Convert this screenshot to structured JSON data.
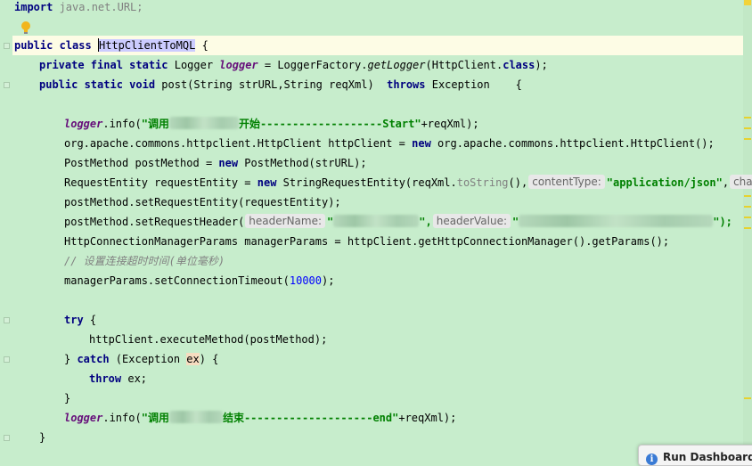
{
  "code": {
    "l0": {
      "kw": "import",
      "rest": " java.net.URL;"
    },
    "l1": {
      "kw1": "public",
      "kw2": "class",
      "cls_first": "H",
      "cls_rest": "ttpClientToMQL",
      "brace": " {"
    },
    "l2": {
      "kw": "private final static",
      "type": " Logger ",
      "field": "logger",
      "rest1": " = LoggerFactory.",
      "method": "getLogger",
      "rest2": "(HttpClient.",
      "kwclass": "class",
      "end": ");"
    },
    "l3": {
      "kw1": "public static void",
      "sig": " post(String strURL,String reqXml)  ",
      "kw2": "throws",
      "rest": " Exception    {"
    },
    "l4": {
      "field": "logger",
      "call": ".info(",
      "str1": "\"调用",
      "str2": "开始-------------------Start\"",
      "rest": "+reqXml);"
    },
    "l5": {
      "pre": "org.apache.commons.httpclient.HttpClient httpClient = ",
      "kw": "new",
      "post": " org.apache.commons.httpclient.HttpClient();"
    },
    "l6": {
      "pre": "PostMethod postMethod = ",
      "kw": "new",
      "post": " PostMethod(strURL);"
    },
    "l7": {
      "pre": "RequestEntity requestEntity = ",
      "kw": "new",
      "post": " StringRequestEntity(reqXml.",
      "m": "toString",
      "after": "(),",
      "hint1": "contentType:",
      "str": "\"application/json\"",
      "comma": ",",
      "hint2": "charse"
    },
    "l8": {
      "text": "postMethod.setRequestEntity(requestEntity);"
    },
    "l9": {
      "pre": "postMethod.setRequestHeader(",
      "hint1": "headerName:",
      "q1": "\"",
      "c1": "\",",
      "hint2": "headerValue:",
      "q2": "\"",
      "c2": "\");"
    },
    "l10": {
      "text": "HttpConnectionManagerParams managerParams = httpClient.getHttpConnectionManager().getParams();"
    },
    "l11": {
      "cmt": "// 设置连接超时时间(单位毫秒)"
    },
    "l12": {
      "pre": "managerParams.setConnectionTimeout(",
      "num": "10000",
      "post": ");"
    },
    "l13": {
      "kw": "try",
      "rest": " {"
    },
    "l14": {
      "text": "httpClient.executeMethod(postMethod);"
    },
    "l15": {
      "pre": "} ",
      "kw": "catch",
      "mid": " (Exception ",
      "var": "ex",
      "post": ") {"
    },
    "l16": {
      "kw": "throw",
      "rest": " ex;"
    },
    "l17": {
      "text": "}"
    },
    "l18": {
      "field": "logger",
      "call": ".info(",
      "str1": "\"调用",
      "str2": "结束--------------------end\"",
      "rest": "+reqXml);"
    },
    "l19": {
      "text": "}"
    }
  },
  "dashboard": {
    "label": "Run Dashboard"
  },
  "colors": {
    "background": "#c7edcc",
    "keyword": "#000080",
    "string": "#008000",
    "number": "#0000ff",
    "field": "#660e7a",
    "comment": "#808080"
  },
  "icons": {
    "bulb": "lightbulb-icon",
    "info": "info-icon"
  }
}
